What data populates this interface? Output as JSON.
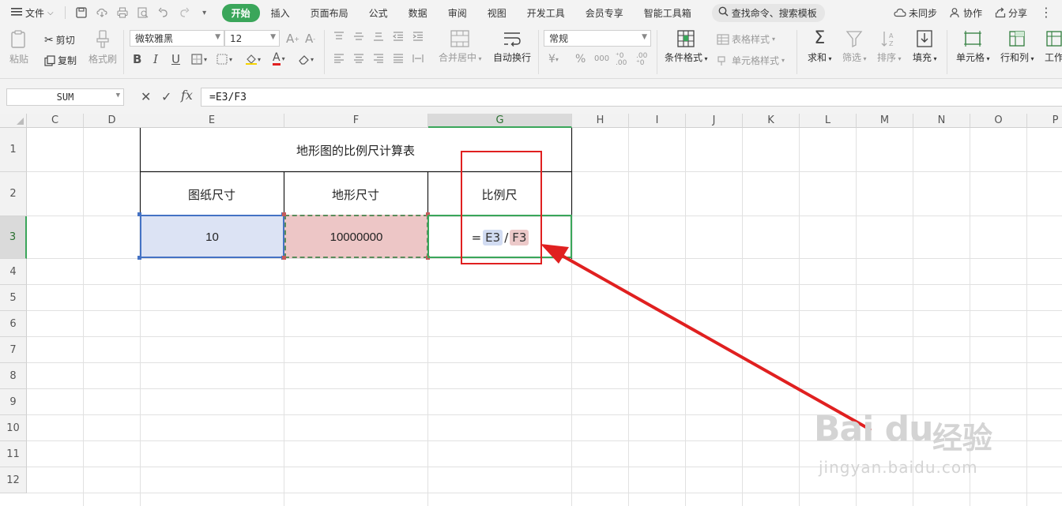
{
  "menubar": {
    "file_label": "文件",
    "tabs": [
      {
        "label": "开始",
        "active": true
      },
      {
        "label": "插入"
      },
      {
        "label": "页面布局"
      },
      {
        "label": "公式"
      },
      {
        "label": "数据"
      },
      {
        "label": "审阅"
      },
      {
        "label": "视图"
      },
      {
        "label": "开发工具"
      },
      {
        "label": "会员专享"
      },
      {
        "label": "智能工具箱"
      }
    ],
    "search_label": "查找命令、搜索模板",
    "sync_label": "未同步",
    "collab_label": "协作",
    "share_label": "分享"
  },
  "ribbon": {
    "paste_label": "粘贴",
    "cut_label": "剪切",
    "copy_label": "复制",
    "format_painter_label": "格式刷",
    "font_name": "微软雅黑",
    "font_size": "12",
    "merge_label": "合并居中",
    "wrap_label": "自动换行",
    "number_format": "常规",
    "conditional_format_label": "条件格式",
    "table_style_label": "表格样式",
    "cell_style_label": "单元格样式",
    "sum_label": "求和",
    "filter_label": "筛选",
    "sort_label": "排序",
    "fill_label": "填充",
    "cell_label": "单元格",
    "rowcol_label": "行和列",
    "sheet_label": "工作"
  },
  "formula_bar": {
    "name_box": "SUM",
    "formula": "=E3/F3",
    "fx_label": "fx"
  },
  "grid": {
    "columns": [
      "C",
      "D",
      "E",
      "F",
      "G",
      "H",
      "I",
      "J",
      "K",
      "L",
      "M",
      "N",
      "O",
      "P"
    ],
    "selected_column": "G",
    "rows": [
      "1",
      "2",
      "3",
      "4",
      "5",
      "6",
      "7",
      "8",
      "9",
      "10",
      "11",
      "12"
    ],
    "selected_row": "3"
  },
  "table": {
    "title": "地形图的比例尺计算表",
    "headers": [
      "图纸尺寸",
      "地形尺寸",
      "比例尺"
    ],
    "e3": "10",
    "f3": "10000000",
    "g3_eq": "=",
    "g3_ref1": "E3",
    "g3_op": "/",
    "g3_ref2": "F3"
  },
  "watermark": {
    "logo_text": "Bai du",
    "cn_text": "经验",
    "url": "jingyan.baidu.com"
  },
  "colors": {
    "accent_green": "#3aa65a",
    "annotation_red": "#e02020",
    "ref_blue": "#d2dcf2",
    "ref_red": "#ecc9c9"
  }
}
